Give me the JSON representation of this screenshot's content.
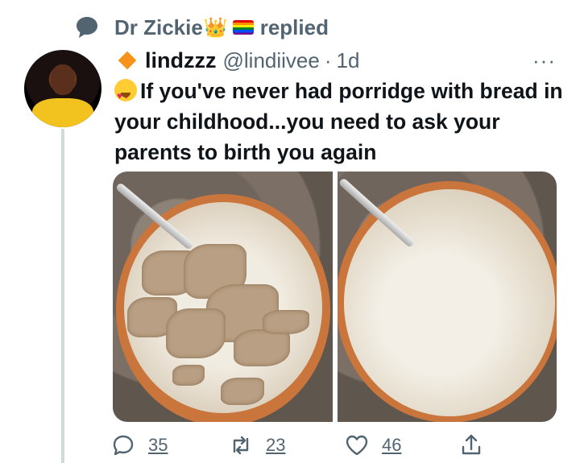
{
  "context": {
    "replier_name": "Dr Zickie",
    "replier_badges": [
      "crown-emoji",
      "rainbow-flag-emoji"
    ],
    "action": "replied"
  },
  "tweet": {
    "author_name": "lindzzz",
    "author_handle": "@lindiivee",
    "separator": "·",
    "age": "1d",
    "more_label": "···",
    "text": "If you've never had porridge with bread in your childhood...you need to ask your parents to birth you again"
  },
  "media": {
    "photos": [
      {
        "description_icon": "porridge-with-bread-photo"
      },
      {
        "description_icon": "porridge-mixed-photo"
      }
    ]
  },
  "metrics": {
    "replies": "35",
    "retweets": "23",
    "likes": "46"
  },
  "colors": {
    "secondary_text": "#536471",
    "primary_text": "#0f1419",
    "thread_line": "#cfd9de"
  }
}
